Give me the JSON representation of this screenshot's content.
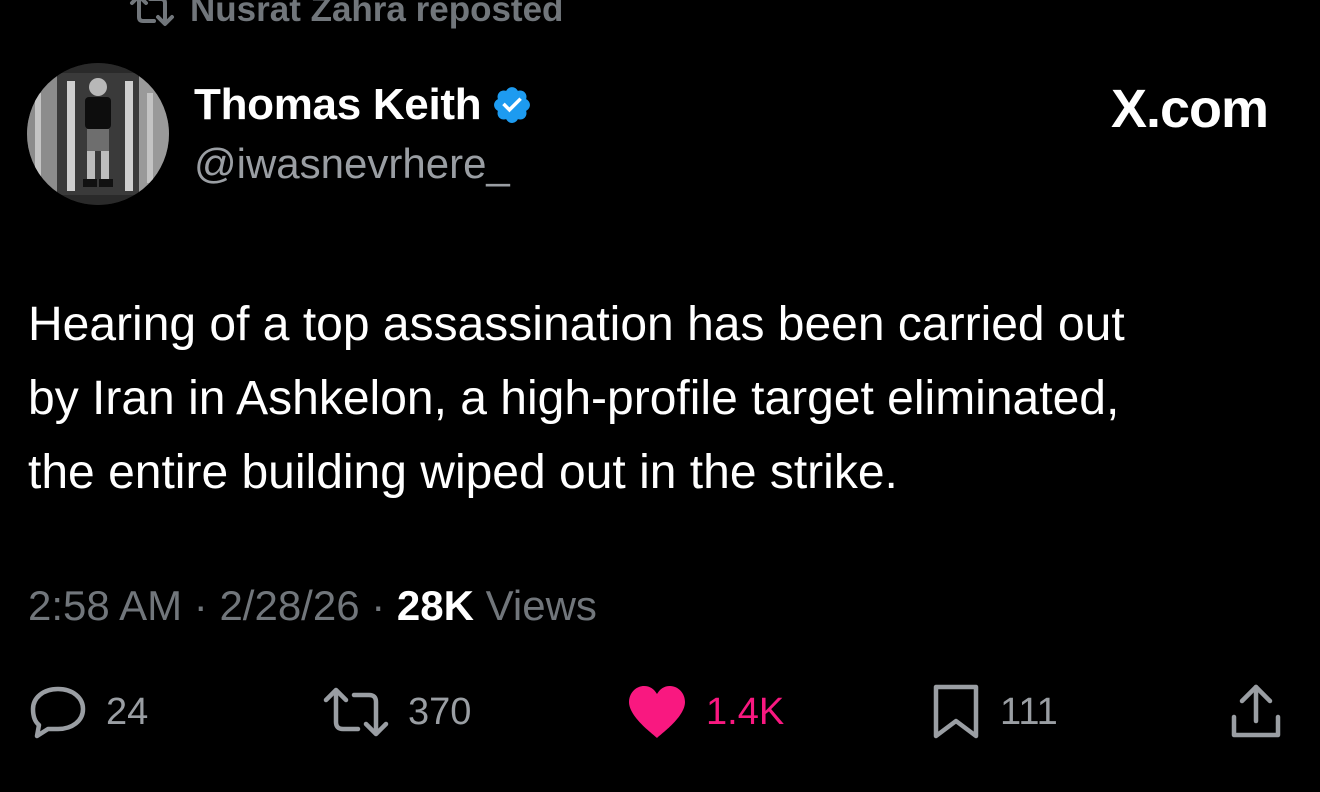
{
  "repost_banner": {
    "icon": "repost-icon",
    "text": "Nusrat Zahra reposted"
  },
  "author": {
    "display_name": "Thomas Keith",
    "verified_icon": "verified-badge-icon",
    "verified_color": "#1d9bf0",
    "handle": "@iwasnevrhere_"
  },
  "brand": {
    "label": "X.com"
  },
  "tweet": {
    "lines": [
      "Hearing of a top assassination has been carried out",
      "by Iran in Ashkelon, a high-profile target eliminated,",
      "the entire building wiped out in the strike."
    ]
  },
  "meta": {
    "time": "2:58 AM",
    "sep1": " · ",
    "date": "2/28/26",
    "sep2": " · ",
    "views_count": "28K",
    "views_label": " Views"
  },
  "actions": {
    "reply": {
      "icon": "reply-icon",
      "count": "24"
    },
    "repost": {
      "icon": "repost-icon",
      "count": "370"
    },
    "like": {
      "icon": "heart-icon",
      "count": "1.4K",
      "color": "#f91880"
    },
    "bookmark": {
      "icon": "bookmark-icon",
      "count": "111"
    },
    "share": {
      "icon": "share-icon"
    }
  }
}
